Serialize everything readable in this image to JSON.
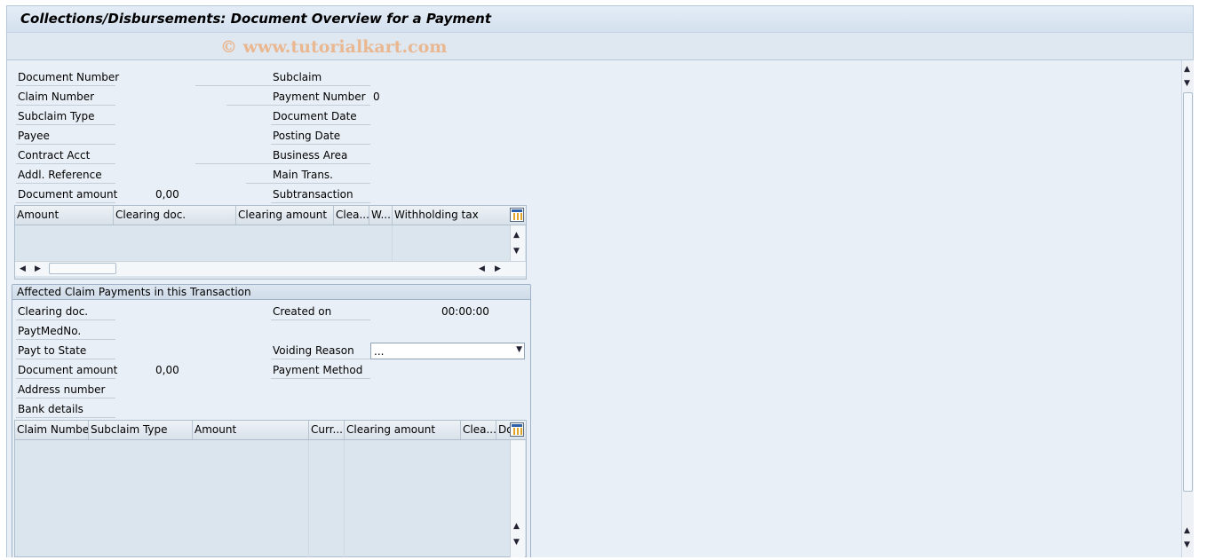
{
  "window": {
    "title": "Collections/Disbursements: Document Overview for a Payment",
    "watermark": "© www.tutorialkart.com"
  },
  "header_fields": {
    "document_number": "Document Number",
    "claim_number": "Claim Number",
    "subclaim_type": "Subclaim Type",
    "payee": "Payee",
    "contract_acct": "Contract Acct",
    "addl_reference": "Addl. Reference",
    "document_amount": "Document amount",
    "document_amount_value": "0,00",
    "subclaim": "Subclaim",
    "payment_number": "Payment Number",
    "payment_number_value": "0",
    "document_date": "Document Date",
    "posting_date": "Posting Date",
    "business_area": "Business Area",
    "main_trans": "Main Trans.",
    "subtransaction": "Subtransaction"
  },
  "clearing_table": {
    "columns": [
      "Amount",
      "Clearing doc.",
      "Clearing amount",
      "Clea...",
      "W...",
      "Withholding tax"
    ],
    "rows": []
  },
  "affected_group": {
    "title": "Affected Claim Payments in this Transaction",
    "clearing_doc": "Clearing doc.",
    "paytmedno": "PaytMedNo.",
    "payt_to_state": "Payt to State",
    "document_amount": "Document amount",
    "document_amount_value": "0,00",
    "address_number": "Address number",
    "bank_details": "Bank details",
    "created_on": "Created on",
    "created_on_time": "00:00:00",
    "voiding_reason": "Voiding Reason",
    "voiding_reason_value": "...",
    "payment_method": "Payment Method"
  },
  "claims_table": {
    "columns": [
      "Claim Number",
      "Subclaim Type",
      "Amount",
      "Curr...",
      "Clearing amount",
      "Clea...",
      "Do"
    ],
    "rows": []
  },
  "icons": {
    "table_settings": "table-settings-icon",
    "scroll_up": "▲",
    "scroll_down": "▼",
    "scroll_left": "◀",
    "scroll_right": "▶"
  }
}
